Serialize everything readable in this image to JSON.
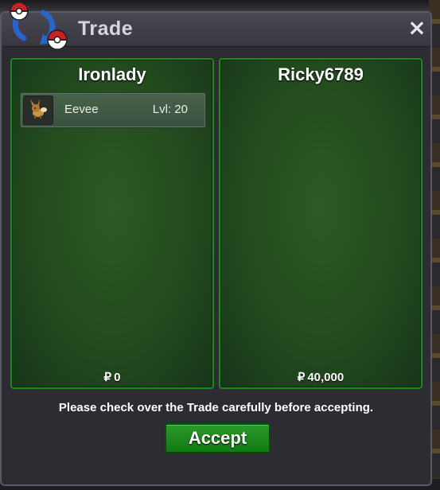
{
  "window": {
    "title": "Trade",
    "close_label": "×"
  },
  "trade": {
    "left": {
      "player": "Ironlady",
      "currency_symbol": "₽",
      "money": "0",
      "pokemon": [
        {
          "name": "Eevee",
          "level": "Lvl: 20",
          "icon": "eevee-sprite-icon"
        }
      ]
    },
    "right": {
      "player": "Ricky6789",
      "currency_symbol": "₽",
      "money": "40,000",
      "pokemon": []
    }
  },
  "footer": {
    "notice": "Please check over the Trade carefully before accepting.",
    "accept_label": "Accept"
  },
  "colors": {
    "panel_border": "#1b8a1b",
    "accept_button": "#1f8a1f",
    "window_bg": "#2e2c33"
  }
}
